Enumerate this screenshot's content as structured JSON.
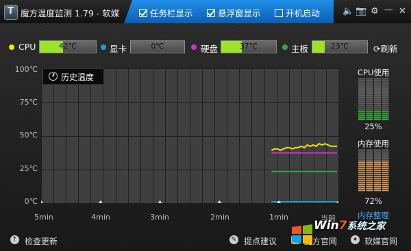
{
  "app": {
    "title": "魔方温度监测 1.79 - 软媒",
    "logo_glyph": "T",
    "options": [
      {
        "label": "任务栏显示",
        "checked": true
      },
      {
        "label": "悬浮窗显示",
        "checked": true
      },
      {
        "label": "开机启动",
        "checked": false
      }
    ],
    "window_buttons": {
      "audio": "🔈",
      "camera": "📷",
      "settings": "⚙",
      "minimize": "—",
      "close": "✕"
    }
  },
  "sensors": [
    {
      "label": "CPU",
      "value": "42℃",
      "percent": 42,
      "dot_color": "#f2e600",
      "fill_color": "#9be42a"
    },
    {
      "label": "显卡",
      "value": "0℃",
      "percent": 0,
      "dot_color": "#1c9ad6",
      "fill_color": "#9be42a"
    },
    {
      "label": "硬盘",
      "value": "37℃",
      "percent": 37,
      "dot_color": "#cc33cc",
      "fill_color": "#9be42a"
    },
    {
      "label": "主板",
      "value": "23℃",
      "percent": 23,
      "dot_color": "#2ea84a",
      "fill_color": "#9be42a"
    }
  ],
  "refresh_label": "刷新",
  "chart": {
    "title": "历史温度",
    "y_ticks": [
      "100℃",
      "75℃",
      "50℃",
      "25℃",
      "0℃"
    ],
    "x_ticks": [
      "5min",
      "4min",
      "3min",
      "2min",
      "1min",
      "当前"
    ]
  },
  "chart_data": {
    "type": "line",
    "title": "历史温度",
    "ylim": [
      0,
      100
    ],
    "y_ticks": [
      "100℃",
      "75℃",
      "50℃",
      "25℃",
      "0℃"
    ],
    "x_ticks": [
      "5min",
      "4min",
      "3min",
      "2min",
      "1min",
      "当前"
    ],
    "grid": true,
    "series": [
      {
        "name": "CPU",
        "color": "#f2e600",
        "values": [
          39,
          40,
          40,
          39,
          40,
          41,
          41,
          40,
          41,
          41,
          42,
          41,
          43,
          42,
          43,
          42,
          44,
          43,
          44,
          43,
          42,
          42,
          42
        ]
      },
      {
        "name": "硬盘",
        "color": "#cc33cc",
        "values": [
          37,
          37,
          37,
          37,
          37,
          37,
          37,
          37,
          37,
          37,
          37,
          37,
          37,
          37,
          37,
          37,
          37,
          37,
          37,
          37,
          37,
          37,
          37
        ]
      },
      {
        "name": "主板",
        "color": "#2ea84a",
        "values": [
          23,
          23,
          23,
          23,
          23,
          23,
          23,
          23,
          23,
          23,
          23,
          23,
          23,
          23,
          23,
          23,
          23,
          23,
          23,
          23,
          23,
          23,
          23
        ]
      },
      {
        "name": "显卡",
        "color": "#1c9ad6",
        "values": [
          0,
          0,
          0,
          0,
          0,
          0,
          0,
          0,
          0,
          0,
          0,
          0,
          0,
          0,
          0,
          0,
          0,
          0,
          0,
          0,
          0,
          0,
          0
        ]
      }
    ]
  },
  "meters": {
    "cpu": {
      "title": "CPU使用",
      "value": "25%",
      "percent": 25,
      "color": "#3fbf3f"
    },
    "memory": {
      "title": "内存使用",
      "value": "72%",
      "percent": 72,
      "color": "#e8a15a"
    },
    "memory_link": "内存整理"
  },
  "bottom": {
    "check_update": "检查更新",
    "suggest": "提点建议",
    "mofang_site": "魔方官网",
    "ruanmei_site": "软媒官网"
  },
  "watermark": {
    "brand_a": "Win",
    "brand_b": "7",
    "text": "系统之家"
  }
}
